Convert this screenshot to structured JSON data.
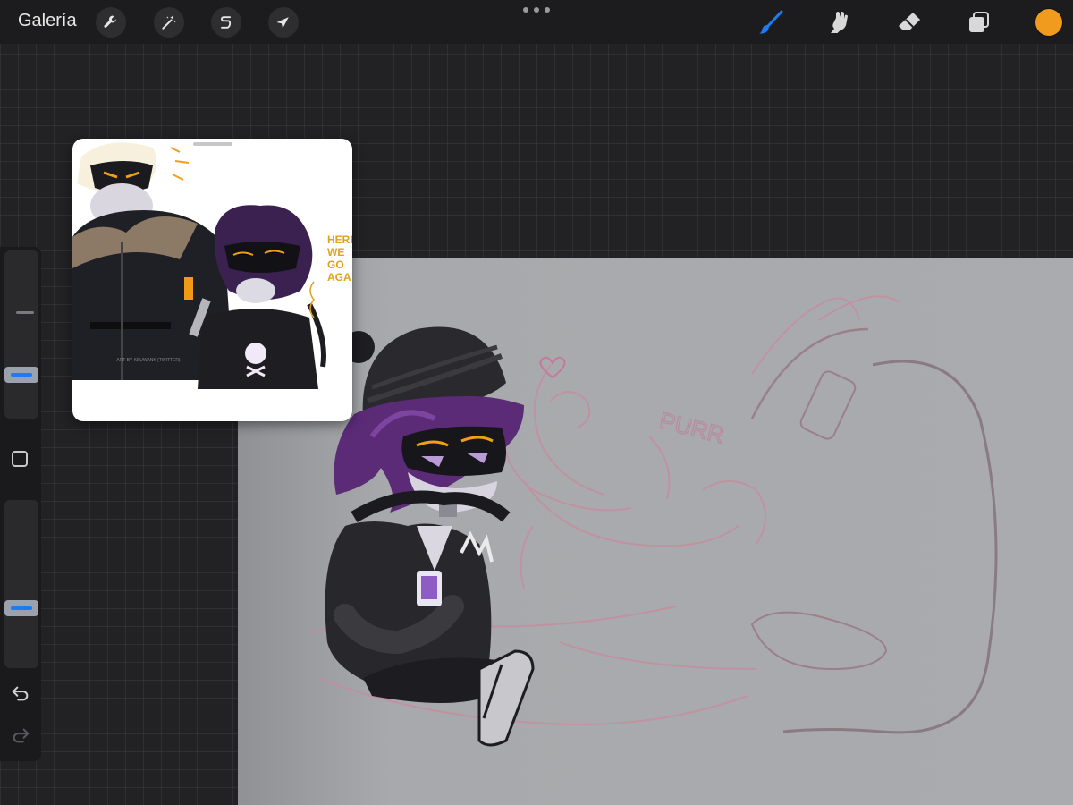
{
  "topbar": {
    "gallery_label": "Galería",
    "left_tools": [
      {
        "name": "actions",
        "icon": "wrench-icon"
      },
      {
        "name": "adjustments",
        "icon": "magic-wand-icon"
      },
      {
        "name": "selection",
        "icon": "selection-s-icon"
      },
      {
        "name": "transform",
        "icon": "arrow-cursor-icon"
      }
    ],
    "right_tools": [
      {
        "name": "brush",
        "icon": "brush-icon",
        "active": true,
        "color": "#1d7cf2"
      },
      {
        "name": "smudge",
        "icon": "smudge-icon"
      },
      {
        "name": "eraser",
        "icon": "eraser-icon"
      },
      {
        "name": "layers",
        "icon": "layers-icon"
      }
    ],
    "current_color": "#f09a1e"
  },
  "sidebar": {
    "brush_size_level": 0.75,
    "opacity_level": 0.3,
    "modify_icon": "square-icon",
    "undo_icon": "undo-icon",
    "redo_icon": "redo-icon"
  },
  "reference": {
    "speech_text": "HERE WE GO AGA",
    "credit_text": "ART BY KSUWANK (TWITTER)"
  },
  "canvas": {
    "sketch_text": "PURR",
    "background": "#a9abae"
  }
}
